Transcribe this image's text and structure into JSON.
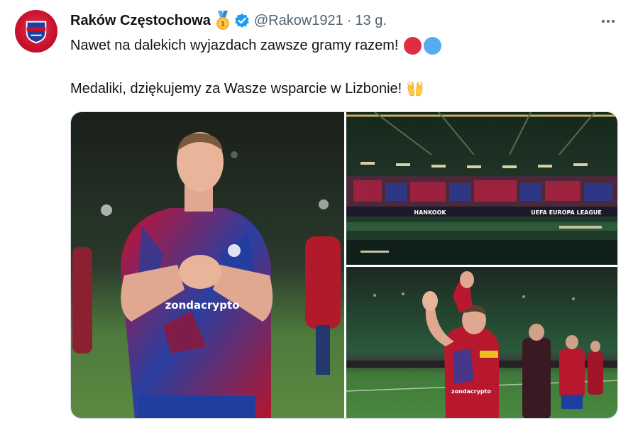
{
  "tweet": {
    "display_name": "Raków Częstochowa",
    "handle": "@Rakow1921",
    "separator": "·",
    "time": "13 g.",
    "line1": "Nawet na dalekich wyjazdach zawsze gramy razem!",
    "line2": "Medaliki, dziękujemy za Wasze wsparcie w Lizbonie!",
    "emoji_line1": [
      "red-circle",
      "blue-circle"
    ],
    "emoji_line2": "raising-hands",
    "badges": [
      "medal-icon",
      "verified-badge-icon"
    ]
  },
  "media": {
    "photos": [
      {
        "description_icon": "player-applauding-photo",
        "jersey_text": "zondacrypto"
      },
      {
        "description_icon": "stadium-stands-photo",
        "board_left": "HANKOOK",
        "board_right": "UEFA EUROPA LEAGUE"
      },
      {
        "description_icon": "players-applauding-fans-photo",
        "jersey_text": "zondacrypto"
      }
    ]
  },
  "colors": {
    "text_primary": "#0f1419",
    "text_secondary": "#536471",
    "verified_blue": "#1d9bf0",
    "club_red": "#c8102e",
    "club_blue": "#1e3fa0"
  }
}
